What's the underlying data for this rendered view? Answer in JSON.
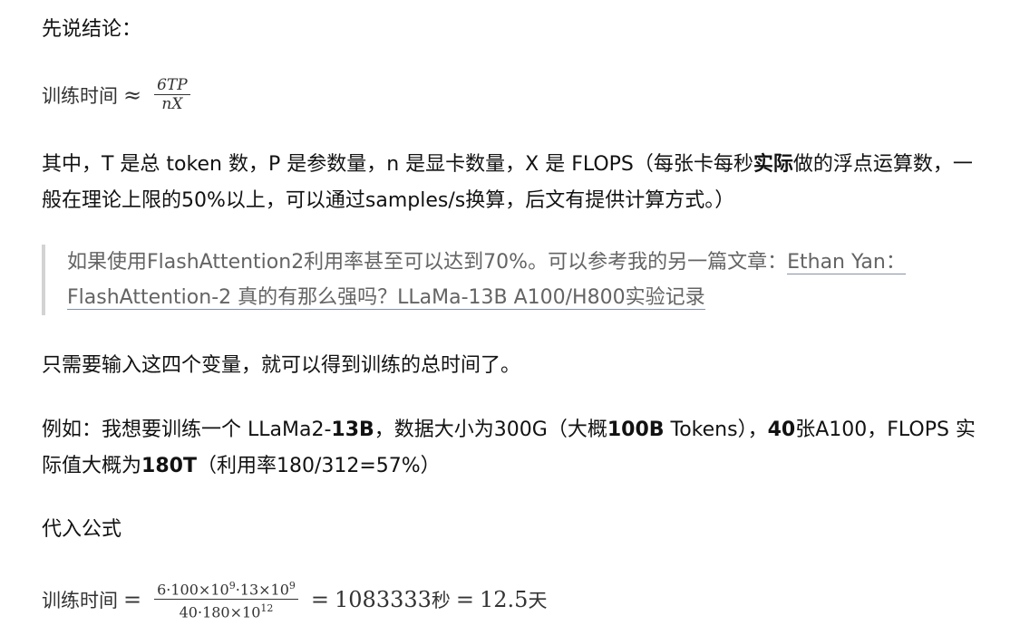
{
  "p_conclusion": "先说结论：",
  "formula1": {
    "label": "训练时间",
    "approx": "≈",
    "numerator": "6TP",
    "denominator": "nX"
  },
  "p_where": {
    "part1": "其中，T 是总 token 数，P 是参数量，n 是显卡数量，X 是 FLOPS（每张卡每秒",
    "bold1": "实际",
    "part2": "做的浮点运算数，一般在理论上限的50%以上，可以通过samples/s换算，后文有提供计算方式。）"
  },
  "quote": {
    "text": "如果使用FlashAttention2利用率甚至可以达到70%。可以参考我的另一篇文章：",
    "link": "Ethan Yan：FlashAttention-2 真的有那么强吗？LLaMa-13B A100/H800实验记录"
  },
  "p_four_vars": "只需要输入这四个变量，就可以得到训练的总时间了。",
  "p_example": {
    "t1": "例如：我想要训练一个 LLaMa2-",
    "b1": "13B",
    "t2": "，数据大小为300G（大概",
    "b2": "100B",
    "t3": " Tokens），",
    "b3": "40",
    "t4": "张A100，FLOPS 实际值大概为",
    "b4": "180T",
    "t5": "（利用率180/312=57%）"
  },
  "p_substitute": "代入公式",
  "formula2": {
    "label": "训练时间",
    "eq1": "=",
    "num_a": "6·100×10",
    "num_a_exp": "9",
    "num_b": "·13×10",
    "num_b_exp": "9",
    "den_a": "40·180×10",
    "den_a_exp": "12",
    "eq2": "=",
    "value_seconds": "1083333",
    "unit_seconds": "秒",
    "eq3": "=",
    "value_days": "12.5",
    "unit_days": "天"
  }
}
